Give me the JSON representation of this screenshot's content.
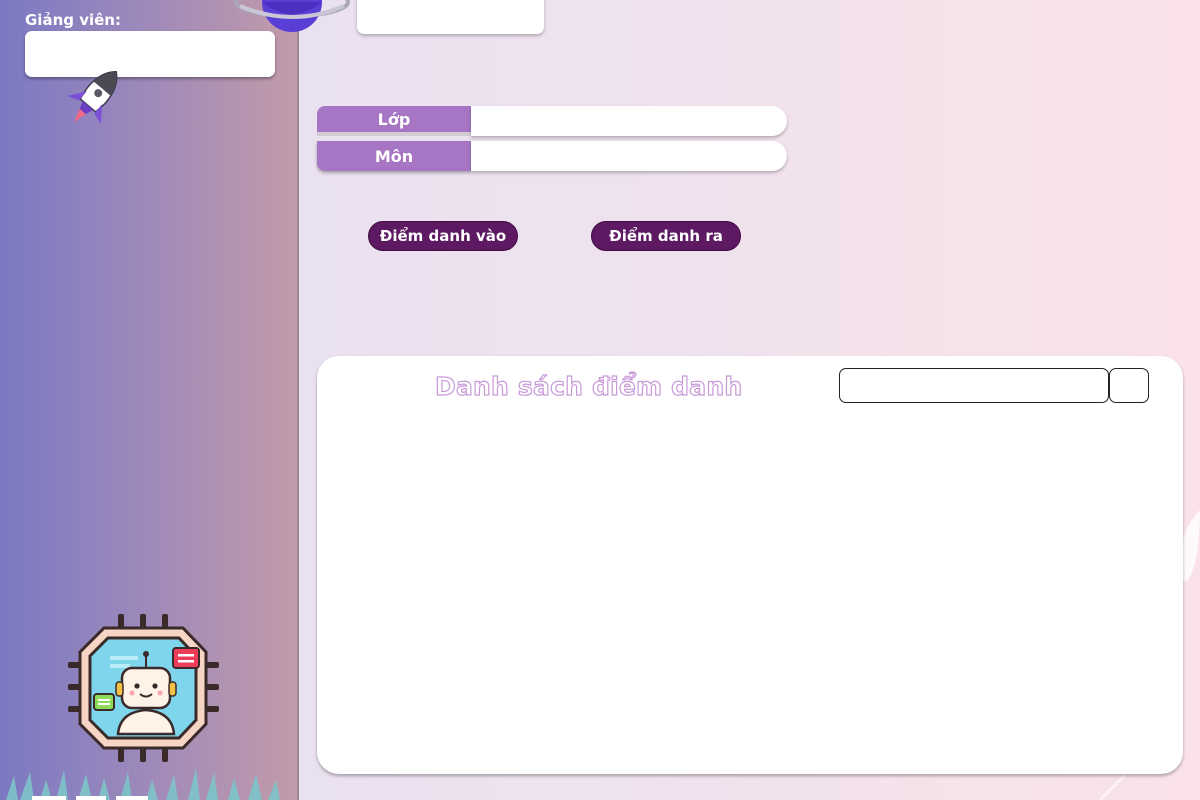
{
  "sidebar": {
    "teacher_label": "Giảng viên:",
    "teacher_value": ""
  },
  "form": {
    "class_label": "Lớp",
    "class_value": "",
    "subject_label": "Môn",
    "subject_value": ""
  },
  "buttons": {
    "check_in": "Điểm danh vào",
    "check_out": "Điểm danh ra"
  },
  "attendance": {
    "title": "Danh sách điểm danh",
    "search_value": ""
  },
  "colors": {
    "accent_purple": "#a675c3",
    "button_dark": "#5e1963",
    "title_outline": "#c89ad8"
  },
  "icons": [
    "rocket-icon",
    "planet-icon",
    "robot-chip-icon",
    "grass-decoration"
  ]
}
